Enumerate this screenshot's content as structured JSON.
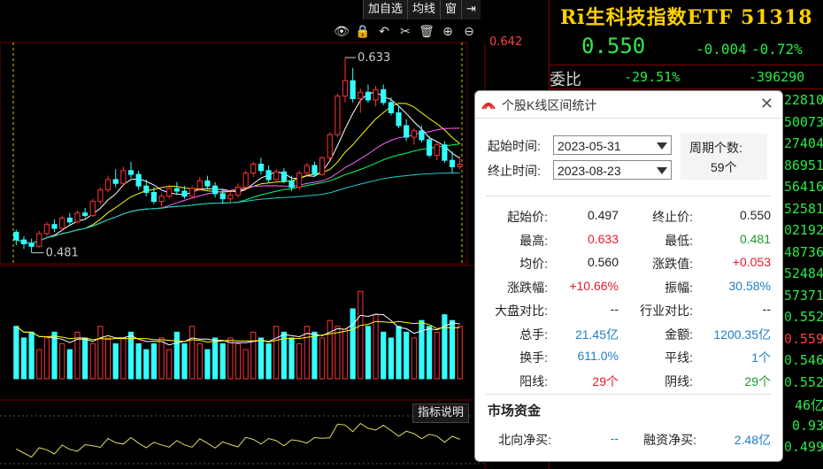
{
  "toolbar": {
    "items": [
      "加自选",
      "均线",
      "窗",
      "⇥"
    ]
  },
  "chart_tools": {
    "icons": [
      "eye-icon",
      "lock-icon",
      "undo-icon",
      "scissors-icon",
      "delete-icon",
      "zoom-in-icon",
      "zoom-out-icon"
    ],
    "glyphs": [
      "👁",
      "🔒",
      "↶",
      "✂",
      "🗑",
      "⊕",
      "⊖"
    ]
  },
  "chart_labels": {
    "high": "0.633",
    "low": "0.481",
    "axis_top": "0.642",
    "indicator_button": "指标说明"
  },
  "chart_data": {
    "type": "candlestick",
    "start_date": "2023-05-31",
    "end_date": "2023-08-23",
    "high": 0.633,
    "low": 0.481,
    "axis_top": 0.642,
    "ohlc": [
      [
        0.497,
        0.499,
        0.487,
        0.491
      ],
      [
        0.491,
        0.494,
        0.484,
        0.488
      ],
      [
        0.488,
        0.492,
        0.481,
        0.486
      ],
      [
        0.486,
        0.498,
        0.485,
        0.496
      ],
      [
        0.496,
        0.505,
        0.494,
        0.503
      ],
      [
        0.503,
        0.507,
        0.497,
        0.5
      ],
      [
        0.5,
        0.51,
        0.498,
        0.508
      ],
      [
        0.508,
        0.512,
        0.503,
        0.505
      ],
      [
        0.505,
        0.514,
        0.504,
        0.512
      ],
      [
        0.512,
        0.516,
        0.508,
        0.51
      ],
      [
        0.51,
        0.523,
        0.509,
        0.521
      ],
      [
        0.521,
        0.532,
        0.519,
        0.53
      ],
      [
        0.53,
        0.541,
        0.528,
        0.538
      ],
      [
        0.538,
        0.546,
        0.532,
        0.535
      ],
      [
        0.535,
        0.548,
        0.533,
        0.545
      ],
      [
        0.545,
        0.552,
        0.539,
        0.542
      ],
      [
        0.542,
        0.545,
        0.53,
        0.533
      ],
      [
        0.533,
        0.538,
        0.525,
        0.528
      ],
      [
        0.528,
        0.532,
        0.519,
        0.521
      ],
      [
        0.521,
        0.527,
        0.517,
        0.525
      ],
      [
        0.525,
        0.534,
        0.523,
        0.531
      ],
      [
        0.531,
        0.536,
        0.526,
        0.529
      ],
      [
        0.529,
        0.533,
        0.523,
        0.525
      ],
      [
        0.525,
        0.533,
        0.523,
        0.531
      ],
      [
        0.531,
        0.54,
        0.529,
        0.537
      ],
      [
        0.537,
        0.541,
        0.53,
        0.533
      ],
      [
        0.533,
        0.536,
        0.524,
        0.527
      ],
      [
        0.527,
        0.531,
        0.519,
        0.523
      ],
      [
        0.523,
        0.528,
        0.52,
        0.526
      ],
      [
        0.526,
        0.535,
        0.524,
        0.532
      ],
      [
        0.532,
        0.545,
        0.531,
        0.543
      ],
      [
        0.543,
        0.552,
        0.54,
        0.55
      ],
      [
        0.55,
        0.555,
        0.542,
        0.545
      ],
      [
        0.545,
        0.549,
        0.536,
        0.538
      ],
      [
        0.538,
        0.546,
        0.537,
        0.544
      ],
      [
        0.544,
        0.547,
        0.535,
        0.537
      ],
      [
        0.537,
        0.541,
        0.529,
        0.532
      ],
      [
        0.532,
        0.545,
        0.53,
        0.543
      ],
      [
        0.543,
        0.551,
        0.541,
        0.549
      ],
      [
        0.549,
        0.552,
        0.54,
        0.542
      ],
      [
        0.542,
        0.556,
        0.541,
        0.555
      ],
      [
        0.555,
        0.575,
        0.553,
        0.573
      ],
      [
        0.573,
        0.605,
        0.571,
        0.603
      ],
      [
        0.603,
        0.633,
        0.598,
        0.615
      ],
      [
        0.615,
        0.625,
        0.598,
        0.601
      ],
      [
        0.601,
        0.609,
        0.59,
        0.606
      ],
      [
        0.606,
        0.612,
        0.598,
        0.6
      ],
      [
        0.6,
        0.611,
        0.595,
        0.608
      ],
      [
        0.608,
        0.612,
        0.596,
        0.598
      ],
      [
        0.598,
        0.602,
        0.588,
        0.59
      ],
      [
        0.59,
        0.596,
        0.578,
        0.58
      ],
      [
        0.58,
        0.585,
        0.568,
        0.571
      ],
      [
        0.571,
        0.578,
        0.565,
        0.576
      ],
      [
        0.576,
        0.58,
        0.567,
        0.569
      ],
      [
        0.569,
        0.572,
        0.555,
        0.557
      ],
      [
        0.557,
        0.567,
        0.553,
        0.565
      ],
      [
        0.565,
        0.568,
        0.551,
        0.553
      ],
      [
        0.553,
        0.56,
        0.543,
        0.548
      ],
      [
        0.548,
        0.556,
        0.546,
        0.55
      ]
    ],
    "volume": [
      0.9,
      0.7,
      0.8,
      0.5,
      0.7,
      0.8,
      0.6,
      0.5,
      0.8,
      0.7,
      0.6,
      0.9,
      0.7,
      0.6,
      0.7,
      0.8,
      0.6,
      0.5,
      0.6,
      0.7,
      0.5,
      0.8,
      0.6,
      0.9,
      0.6,
      0.5,
      0.7,
      0.6,
      0.7,
      0.6,
      0.5,
      0.8,
      0.7,
      0.6,
      0.9,
      0.8,
      0.7,
      0.6,
      0.9,
      0.8,
      0.7,
      1.0,
      0.9,
      0.85,
      1.2,
      1.5,
      0.9,
      1.1,
      0.8,
      0.7,
      0.9,
      0.8,
      0.7,
      1.0,
      0.9,
      0.8,
      1.1,
      1.0,
      0.9
    ]
  },
  "quote": {
    "title": "Rī生科技指数ETF 51318",
    "price": "0.550",
    "change": "-0.004",
    "change_pct": "-0.72%",
    "weibi_label": "委比",
    "weibi_pct": "-29.51%",
    "weibi_val": "-396290",
    "edge_values": [
      {
        "text": "22810",
        "color": "#2ee84a"
      },
      {
        "text": "50073",
        "color": "#2ee84a"
      },
      {
        "text": "27404",
        "color": "#2ee84a"
      },
      {
        "text": "86951",
        "color": "#2ee84a"
      },
      {
        "text": "56416",
        "color": "#2ee84a"
      },
      {
        "text": "52581",
        "color": "#2ee84a"
      },
      {
        "text": "02192",
        "color": "#2ee84a"
      },
      {
        "text": "48736",
        "color": "#2ee84a"
      },
      {
        "text": "52484",
        "color": "#2ee84a"
      },
      {
        "text": "57371",
        "color": "#2ee84a"
      },
      {
        "text": "0.552",
        "color": "#2ee84a"
      },
      {
        "text": "0.559",
        "color": "#ff4040"
      },
      {
        "text": "0.546",
        "color": "#2ee84a"
      },
      {
        "text": "0.552",
        "color": "#2ee84a"
      },
      {
        "text": "46亿",
        "color": "#2ee84a"
      },
      {
        "text": "0.93",
        "color": "#2ee84a"
      },
      {
        "text": "0.499",
        "color": "#2ee84a"
      }
    ]
  },
  "dialog": {
    "title": "个股K线区间统计",
    "start_label": "起始时间:",
    "start_value": "2023-05-31",
    "end_label": "终止时间:",
    "end_value": "2023-08-23",
    "period_label": "周期个数:",
    "period_value": "59个",
    "rows": [
      {
        "l1": "起始价:",
        "v1": "0.497",
        "c1": "",
        "l2": "终止价:",
        "v2": "0.550",
        "c2": ""
      },
      {
        "l1": "最高:",
        "v1": "0.633",
        "c1": "red",
        "l2": "最低:",
        "v2": "0.481",
        "c2": "green"
      },
      {
        "l1": "均价:",
        "v1": "0.560",
        "c1": "",
        "l2": "涨跌值:",
        "v2": "+0.053",
        "c2": "red"
      },
      {
        "l1": "涨跌幅:",
        "v1": "+10.66%",
        "c1": "red",
        "l2": "振幅:",
        "v2": "30.58%",
        "c2": "blue"
      },
      {
        "l1": "大盘对比:",
        "v1": "--",
        "c1": "",
        "l2": "行业对比:",
        "v2": "--",
        "c2": ""
      },
      {
        "l1": "总手:",
        "v1": "21.45亿",
        "c1": "blue",
        "l2": "金额:",
        "v2": "1200.35亿",
        "c2": "blue"
      },
      {
        "l1": "换手:",
        "v1": "611.0%",
        "c1": "blue",
        "l2": "平线:",
        "v2": "1个",
        "c2": "blue"
      },
      {
        "l1": "阳线:",
        "v1": "29个",
        "c1": "red",
        "l2": "阴线:",
        "v2": "29个",
        "c2": "green"
      }
    ],
    "market_title": "市场资金",
    "north_label": "北向净买:",
    "north_value": "--",
    "margin_label": "融资净买:",
    "margin_value": "2.48亿"
  }
}
